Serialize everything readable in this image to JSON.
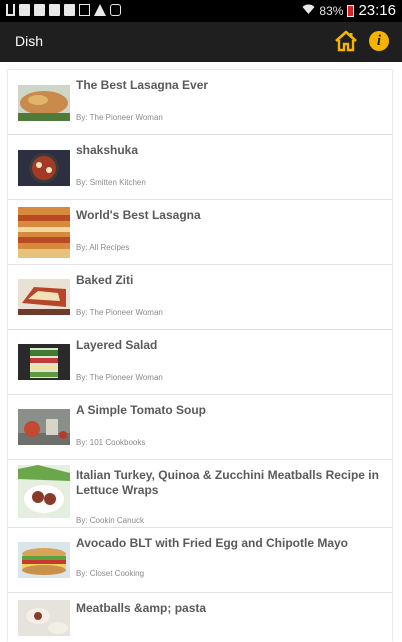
{
  "status_bar": {
    "battery": "83%",
    "time": "23:16"
  },
  "action_bar": {
    "title": "Dish"
  },
  "recipes": [
    {
      "title": "The Best Lasagna Ever",
      "author": "By: The Pioneer Woman"
    },
    {
      "title": "shakshuka",
      "author": "By: Smitten Kitchen"
    },
    {
      "title": "World's Best Lasagna",
      "author": "By: All Recipes"
    },
    {
      "title": "Baked Ziti",
      "author": "By: The Pioneer Woman"
    },
    {
      "title": "Layered Salad",
      "author": "By: The Pioneer Woman"
    },
    {
      "title": "A Simple Tomato Soup",
      "author": "By: 101 Cookbooks"
    },
    {
      "title": "Italian Turkey, Quinoa & Zucchini Meatballs Recipe in Lettuce Wraps",
      "author": "By: Cookin Canuck"
    },
    {
      "title": "Avocado BLT with Fried Egg and Chipotle Mayo",
      "author": "By: Closet Cooking"
    },
    {
      "title": "Meatballs &amp; pasta",
      "author": ""
    }
  ]
}
